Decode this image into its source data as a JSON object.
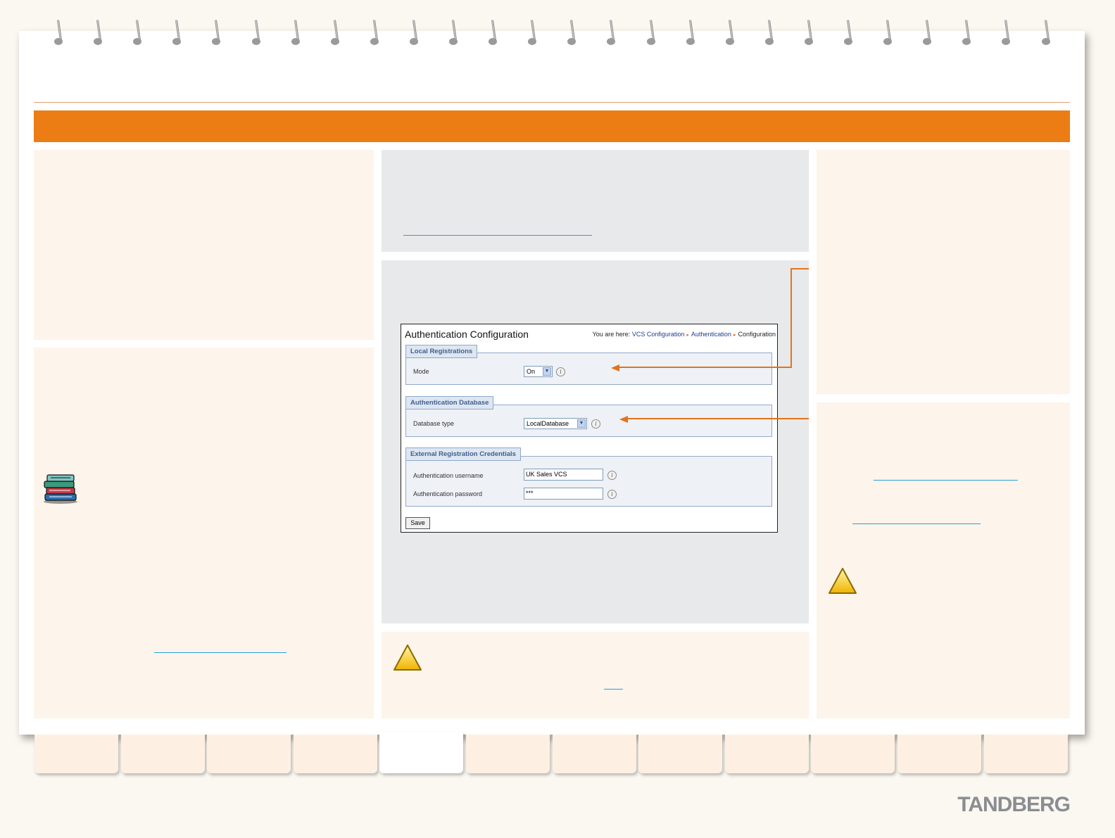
{
  "screenshot": {
    "title": "Authentication Configuration",
    "breadcrumb": {
      "prefix": "You are here:",
      "items": [
        "VCS Configuration",
        "Authentication",
        "Configuration"
      ]
    },
    "sections": {
      "local_registrations": {
        "legend": "Local Registrations",
        "mode_label": "Mode",
        "mode_value": "On"
      },
      "authentication_database": {
        "legend": "Authentication Database",
        "db_type_label": "Database type",
        "db_type_value": "LocalDatabase"
      },
      "external_credentials": {
        "legend": "External Registration Credentials",
        "username_label": "Authentication username",
        "username_value": "UK Sales VCS",
        "password_label": "Authentication password",
        "password_value": "***"
      }
    },
    "save_label": "Save",
    "info_glyph": "i"
  },
  "icons": {
    "books": "books-icon",
    "warning": "warning-icon",
    "select_arrow": "chevron-down-icon",
    "info": "info-icon"
  },
  "colors": {
    "header_band": "#ec7c14",
    "link": "#2aa0d4",
    "arrow": "#e2731c"
  },
  "brand": "TANDBERG",
  "tabs": {
    "count": 12,
    "active_index": 4
  }
}
